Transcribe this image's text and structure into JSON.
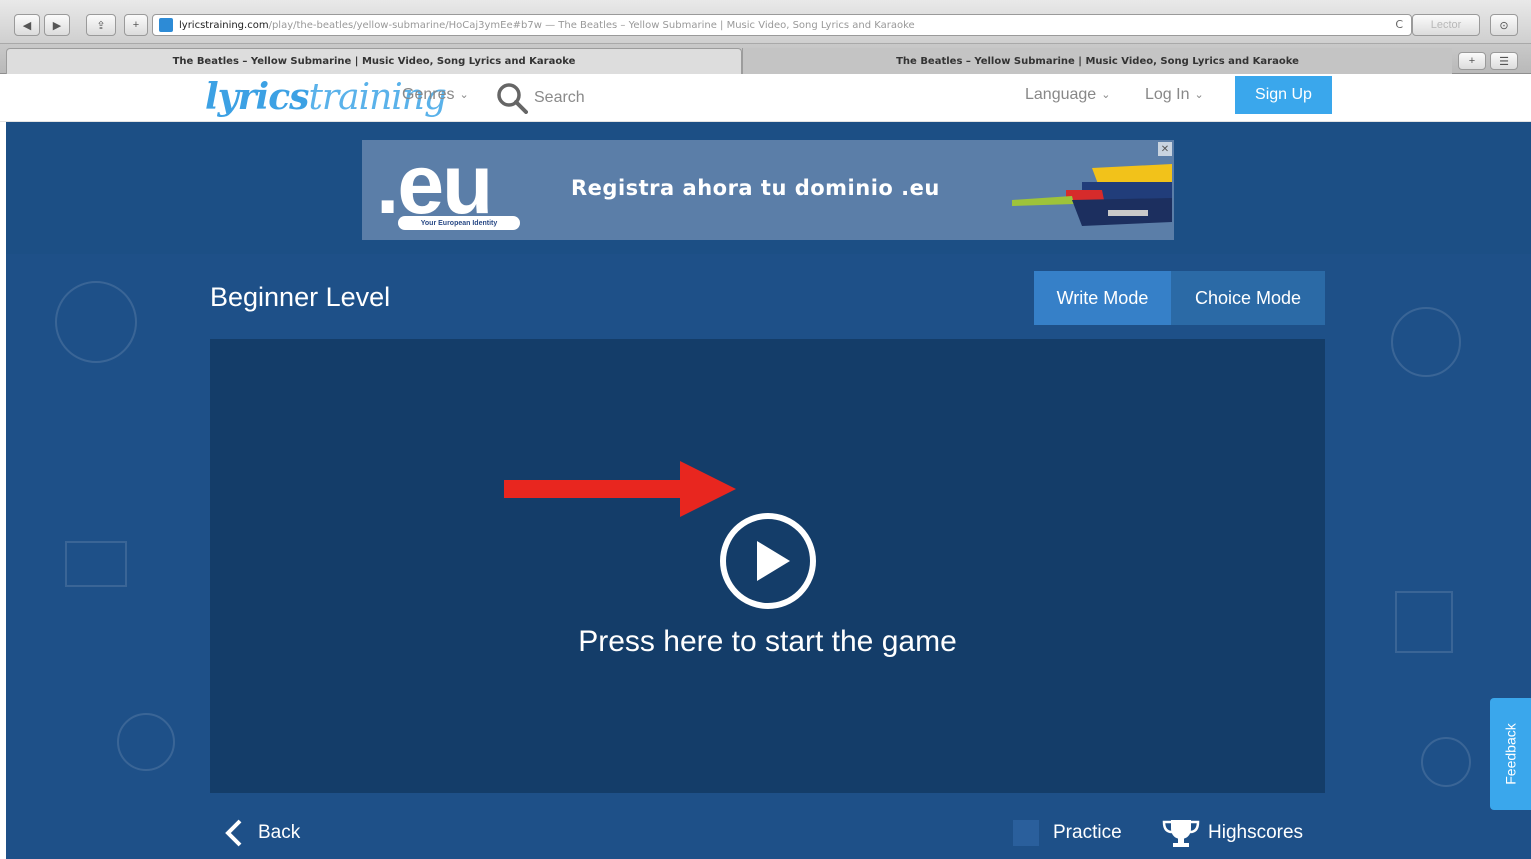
{
  "browser": {
    "address_host": "lyricstraining.com",
    "address_path": "/play/the-beatles/yellow-submarine/HoCaj3ymEe#b7w — The Beatles – Yellow Submarine | Music Video, Song Lyrics and Karaoke",
    "reader_label": "Lector",
    "tabs": [
      {
        "label": "The Beatles – Yellow Submarine | Music Video, Song Lyrics and Karaoke",
        "active": true
      },
      {
        "label": "The Beatles – Yellow Submarine | Music Video, Song Lyrics and Karaoke",
        "active": false
      }
    ]
  },
  "header": {
    "logo_bold": "lyrics",
    "logo_light": "training",
    "genres_label": "Genres",
    "search_placeholder": "Search",
    "language_label": "Language",
    "login_label": "Log In",
    "signup_label": "Sign Up"
  },
  "ad": {
    "logo_text": ".eu",
    "tagline": "Your European Identity",
    "headline": "Registra ahora tu dominio .eu",
    "close_label": "✕"
  },
  "game": {
    "level_title": "Beginner Level",
    "write_mode_label": "Write Mode",
    "choice_mode_label": "Choice Mode",
    "start_prompt": "Press here to start the game"
  },
  "footer": {
    "back_label": "Back",
    "practice_label": "Practice",
    "highscores_label": "Highscores",
    "feedback_label": "Feedback"
  },
  "colors": {
    "brand_blue": "#3aa7ec",
    "page_bg": "#1c4f85",
    "player_bg": "#143d69",
    "arrow_red": "#e8261f"
  }
}
